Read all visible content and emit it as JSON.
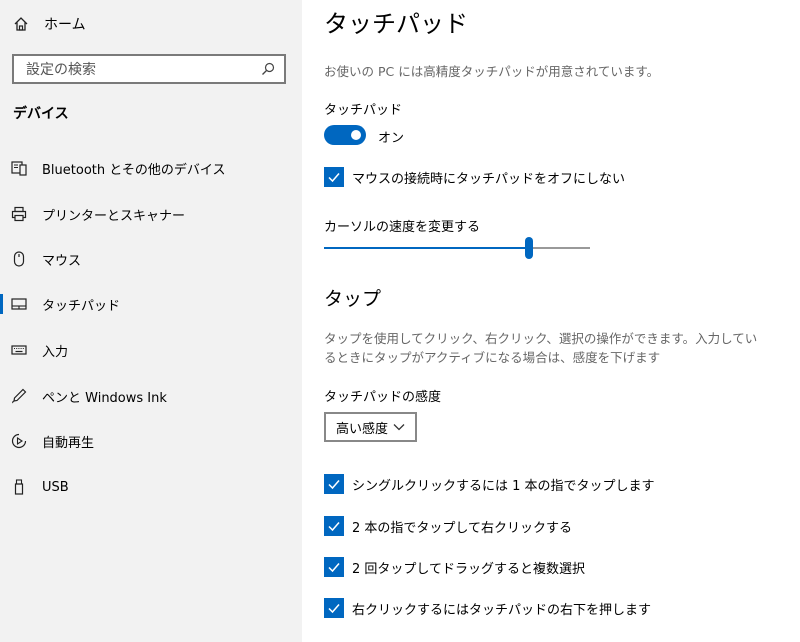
{
  "sidebar": {
    "home_label": "ホーム",
    "search_placeholder": "設定の検索",
    "section_title": "デバイス",
    "items": [
      {
        "label": "Bluetooth とその他のデバイス",
        "icon": "bluetooth-devices-icon"
      },
      {
        "label": "プリンターとスキャナー",
        "icon": "printer-icon"
      },
      {
        "label": "マウス",
        "icon": "mouse-icon"
      },
      {
        "label": "タッチパッド",
        "icon": "touchpad-icon",
        "selected": true
      },
      {
        "label": "入力",
        "icon": "keyboard-icon"
      },
      {
        "label": "ペンと Windows Ink",
        "icon": "pen-icon"
      },
      {
        "label": "自動再生",
        "icon": "autoplay-icon"
      },
      {
        "label": "USB",
        "icon": "usb-icon"
      }
    ]
  },
  "main": {
    "title": "タッチパッド",
    "description": "お使いの PC には高精度タッチパッドが用意されています。",
    "touchpad_label": "タッチパッド",
    "toggle_state": "オン",
    "toggle_on": true,
    "leave_on_mouse": "マウスの接続時にタッチパッドをオフにしない",
    "cursor_speed_label": "カーソルの速度を変更する",
    "cursor_speed_fraction": 0.77,
    "tap_section_title": "タップ",
    "tap_description": "タップを使用してクリック、右クリック、選択の操作ができます。入力しているときにタップがアクティブになる場合は、感度を下げます",
    "sensitivity_label": "タッチパッドの感度",
    "sensitivity_value": "高い感度",
    "options": [
      "シングルクリックするには 1 本の指でタップします",
      "2 本の指でタップして右クリックする",
      "2 回タップしてドラッグすると複数選択",
      "右クリックするにはタッチパッドの右下を押します"
    ]
  },
  "colors": {
    "accent": "#0067c0",
    "sidebar_bg": "#f2f2f2"
  }
}
